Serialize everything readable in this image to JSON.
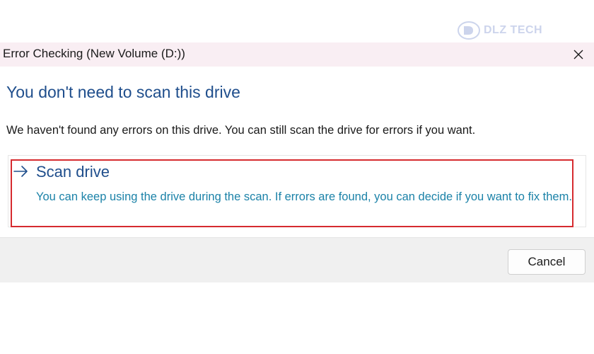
{
  "watermark": {
    "text": "DLZ TECH",
    "icon": "dlz-logo-icon"
  },
  "window": {
    "title": "Error Checking (New Volume (D:))",
    "close_icon": "close-icon"
  },
  "content": {
    "heading": "You don't need to scan this drive",
    "description": "We haven't found any errors on this drive. You can still scan the drive for errors if you want.",
    "option": {
      "icon": "arrow-right-icon",
      "title": "Scan drive",
      "description": "You can keep using the drive during the scan. If errors are found, you can decide if you want to fix them."
    }
  },
  "footer": {
    "cancel_label": "Cancel"
  },
  "colors": {
    "heading": "#1f4e8c",
    "link_description": "#1b82a8",
    "highlight_border": "#d62b2f",
    "titlebar_background": "#f9eef3"
  }
}
